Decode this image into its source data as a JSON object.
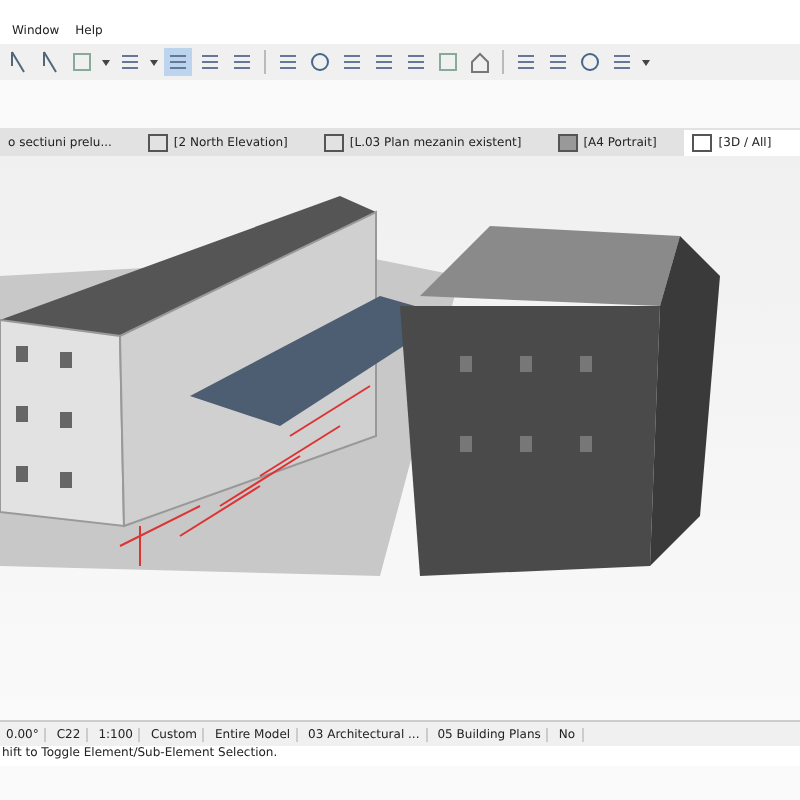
{
  "menu": [
    "Window",
    "Help"
  ],
  "tabs": [
    {
      "label": "o sectiuni prelu...",
      "kind": "section",
      "selected": false
    },
    {
      "label": "[2 North Elevation]",
      "kind": "elevation",
      "selected": false
    },
    {
      "label": "[L.03 Plan mezanin existent]",
      "kind": "plan",
      "selected": false
    },
    {
      "label": "[A4 Portrait]",
      "kind": "layout",
      "selected": false
    },
    {
      "label": "[3D / All]",
      "kind": "perspective",
      "selected": true
    }
  ],
  "status_bar": {
    "angle": "0.00°",
    "layer": "C22",
    "scale": "1:100",
    "pen_set": "Custom",
    "model_view": "Entire Model",
    "view_option": "03 Architectural ...",
    "layer_combo": "05 Building Plans",
    "extra": "No"
  },
  "hint": "hift to Toggle Element/Sub-Element Selection."
}
